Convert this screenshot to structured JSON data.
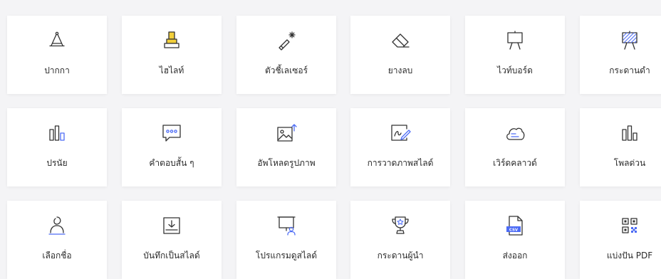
{
  "colors": {
    "accent": "#4d6cf5",
    "highlight": "#f2cf3a",
    "icon": "#333333"
  },
  "tiles": [
    {
      "label": "ปากกา",
      "icon": "pen-icon"
    },
    {
      "label": "ไฮไลท์",
      "icon": "highlighter-icon"
    },
    {
      "label": "ตัวชี้เลเซอร์",
      "icon": "laser-pointer-icon"
    },
    {
      "label": "ยางลบ",
      "icon": "eraser-icon"
    },
    {
      "label": "ไวท์บอร์ด",
      "icon": "whiteboard-icon"
    },
    {
      "label": "กระดานดำ",
      "icon": "blackboard-icon"
    },
    {
      "label": "ปรนัย",
      "icon": "bar-chart-icon"
    },
    {
      "label": "คำตอบสั้น ๆ",
      "icon": "chat-bubble-icon"
    },
    {
      "label": "อัพโหลดรูปภาพ",
      "icon": "image-upload-icon"
    },
    {
      "label": "การวาดภาพสไลด์",
      "icon": "slide-drawing-icon"
    },
    {
      "label": "เวิร์ดคลาวด์",
      "icon": "word-cloud-icon"
    },
    {
      "label": "โพลด่วน",
      "icon": "quick-poll-icon"
    },
    {
      "label": "เลือกชื่อ",
      "icon": "pick-name-icon"
    },
    {
      "label": "บันทึกเป็นสไลด์",
      "icon": "save-as-slide-icon"
    },
    {
      "label": "โปรแกรมดูสไลด์",
      "icon": "slide-viewer-icon"
    },
    {
      "label": "กระดานผู้นำ",
      "icon": "leaderboard-icon"
    },
    {
      "label": "ส่งออก",
      "icon": "csv-export-icon"
    },
    {
      "label": "แบ่งปัน PDF",
      "icon": "qr-share-icon"
    }
  ],
  "csv_badge": "CSV"
}
